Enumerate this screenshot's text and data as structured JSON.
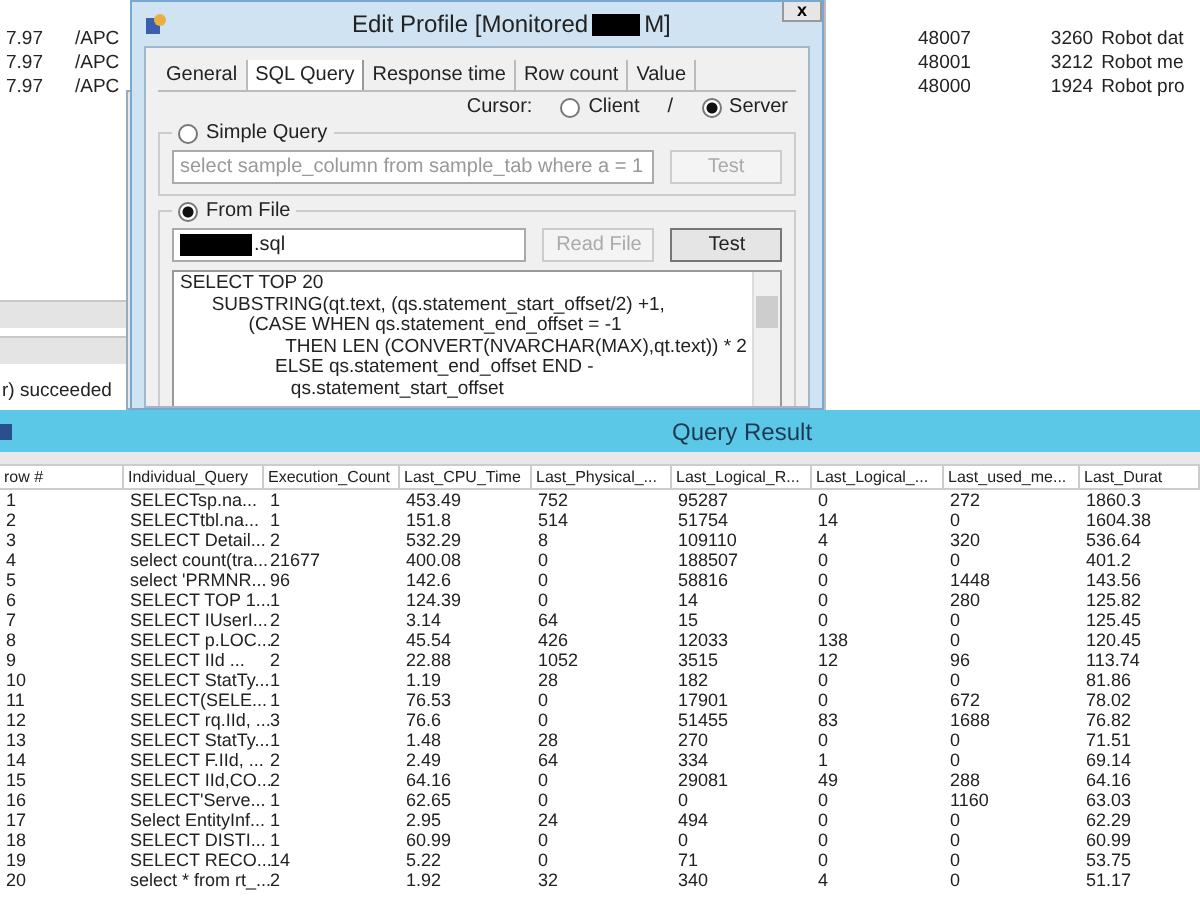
{
  "background_app": {
    "left_rows": [
      {
        "value": "7.97",
        "path": "/APC"
      },
      {
        "value": "7.97",
        "path": "/APC"
      },
      {
        "value": "7.97",
        "path": "/APC"
      }
    ],
    "right_rows": [
      {
        "port": "48007",
        "pid": "3260",
        "name": "Robot dat"
      },
      {
        "port": "48001",
        "pid": "3212",
        "name": "Robot me"
      },
      {
        "port": "48000",
        "pid": "1924",
        "name": "Robot pro"
      }
    ],
    "status": "r) succeeded"
  },
  "dialog": {
    "title_parts": [
      "Edit Profile [Monitored",
      "M]"
    ],
    "close": "x",
    "tabs": [
      {
        "label": "General",
        "selected": false
      },
      {
        "label": "SQL Query",
        "selected": true
      },
      {
        "label": "Response time",
        "selected": false
      },
      {
        "label": "Row count",
        "selected": false
      },
      {
        "label": "Value",
        "selected": false
      }
    ],
    "cursor": {
      "label": "Cursor:",
      "separator": "/",
      "options": [
        {
          "label": "Client",
          "selected": false
        },
        {
          "label": "Server",
          "selected": true
        }
      ]
    },
    "simple_query": {
      "label": "Simple Query",
      "selected": false,
      "placeholder": "select sample_column from sample_tab where a = 1",
      "button": {
        "label": "Test",
        "disabled": true
      }
    },
    "from_file": {
      "label": "From File",
      "selected": true,
      "file_suffix": ".sql",
      "buttons": [
        {
          "label": "Read File",
          "disabled": true
        },
        {
          "label": "Test",
          "disabled": false
        }
      ],
      "sql_lines": [
        "SELECT TOP 20",
        "      SUBSTRING(qt.text, (qs.statement_start_offset/2) +1,",
        "             (CASE WHEN qs.statement_end_offset = -1",
        "                    THEN LEN (CONVERT(NVARCHAR(MAX),qt.text)) * 2",
        "                  ELSE qs.statement_end_offset END -",
        "                     qs.statement_start_offset"
      ]
    }
  },
  "query_result": {
    "title": "Query Result",
    "columns": [
      "row #",
      "Individual_Query",
      "Execution_Count",
      "Last_CPU_Time",
      "Last_Physical_...",
      "Last_Logical_R...",
      "Last_Logical_...",
      "Last_used_me...",
      "Last_Durat"
    ],
    "rows": [
      [
        "1",
        "SELECTsp.na...",
        "1",
        "453.49",
        "752",
        "95287",
        "0",
        "272",
        "1860.3"
      ],
      [
        "2",
        "SELECTtbl.na...",
        "1",
        "151.8",
        "514",
        "51754",
        "14",
        "0",
        "1604.38"
      ],
      [
        "3",
        "SELECT Detail...",
        "2",
        "532.29",
        "8",
        "109110",
        "4",
        "320",
        "536.64"
      ],
      [
        "4",
        "select count(tra...",
        "21677",
        "400.08",
        "0",
        "188507",
        "0",
        "0",
        "401.2"
      ],
      [
        "5",
        "select 'PRMNR...",
        "96",
        "142.6",
        "0",
        "58816",
        "0",
        "1448",
        "143.56"
      ],
      [
        "6",
        "SELECT TOP 1...",
        "1",
        "124.39",
        "0",
        "14",
        "0",
        "280",
        "125.82"
      ],
      [
        "7",
        "SELECT IUserI...",
        "2",
        "3.14",
        "64",
        "15",
        "0",
        "0",
        "125.45"
      ],
      [
        "8",
        "SELECT p.LOC...",
        "2",
        "45.54",
        "426",
        "12033",
        "138",
        "0",
        "120.45"
      ],
      [
        "9",
        "SELECT IId     ...",
        "2",
        "22.88",
        "1052",
        "3515",
        "12",
        "96",
        "113.74"
      ],
      [
        "10",
        "SELECT StatTy...",
        "1",
        "1.19",
        "28",
        "182",
        "0",
        "0",
        "81.86"
      ],
      [
        "11",
        "SELECT(SELE...",
        "1",
        "76.53",
        "0",
        "17901",
        "0",
        "672",
        "78.02"
      ],
      [
        "12",
        "SELECT rq.IId, ...",
        "3",
        "76.6",
        "0",
        "51455",
        "83",
        "1688",
        "76.82"
      ],
      [
        "13",
        "SELECT StatTy...",
        "1",
        "1.48",
        "28",
        "270",
        "0",
        "0",
        "71.51"
      ],
      [
        "14",
        "SELECT F.IId, ...",
        "2",
        "2.49",
        "64",
        "334",
        "1",
        "0",
        "69.14"
      ],
      [
        "15",
        "SELECT IId,CO...",
        "2",
        "64.16",
        "0",
        "29081",
        "49",
        "288",
        "64.16"
      ],
      [
        "16",
        "SELECT'Serve...",
        "1",
        "62.65",
        "0",
        "0",
        "0",
        "1160",
        "63.03"
      ],
      [
        "17",
        "Select EntityInf...",
        "1",
        "2.95",
        "24",
        "494",
        "0",
        "0",
        "62.29"
      ],
      [
        "18",
        "SELECT DISTI...",
        "1",
        "60.99",
        "0",
        "0",
        "0",
        "0",
        "60.99"
      ],
      [
        "19",
        "SELECT RECO...",
        "14",
        "5.22",
        "0",
        "71",
        "0",
        "0",
        "53.75"
      ],
      [
        "20",
        "select * from rt_...",
        "2",
        "1.92",
        "32",
        "340",
        "4",
        "0",
        "51.17"
      ]
    ]
  }
}
